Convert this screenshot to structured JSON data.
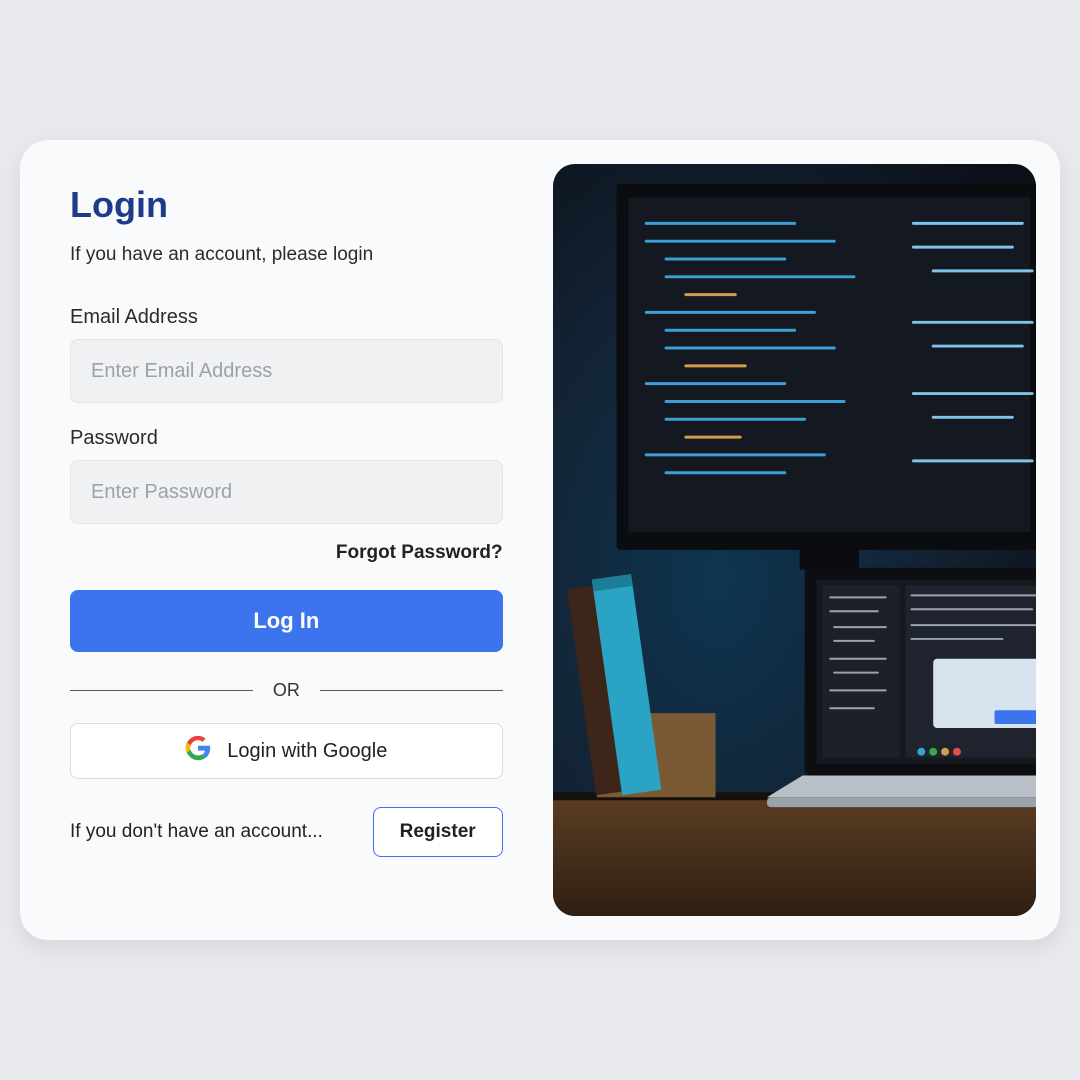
{
  "title": "Login",
  "subtitle": "If you have an account, please login",
  "email": {
    "label": "Email Address",
    "placeholder": "Enter Email Address",
    "value": ""
  },
  "password": {
    "label": "Password",
    "placeholder": "Enter Password",
    "value": ""
  },
  "forgot_label": "Forgot Password?",
  "login_button": "Log In",
  "divider_label": "OR",
  "google_button": "Login with Google",
  "register_prompt": "If you don't have an account...",
  "register_button": "Register",
  "colors": {
    "primary": "#3b74ed",
    "title": "#1e3a8a",
    "card_bg": "#f9fafb",
    "page_bg": "#e7e9ec"
  }
}
